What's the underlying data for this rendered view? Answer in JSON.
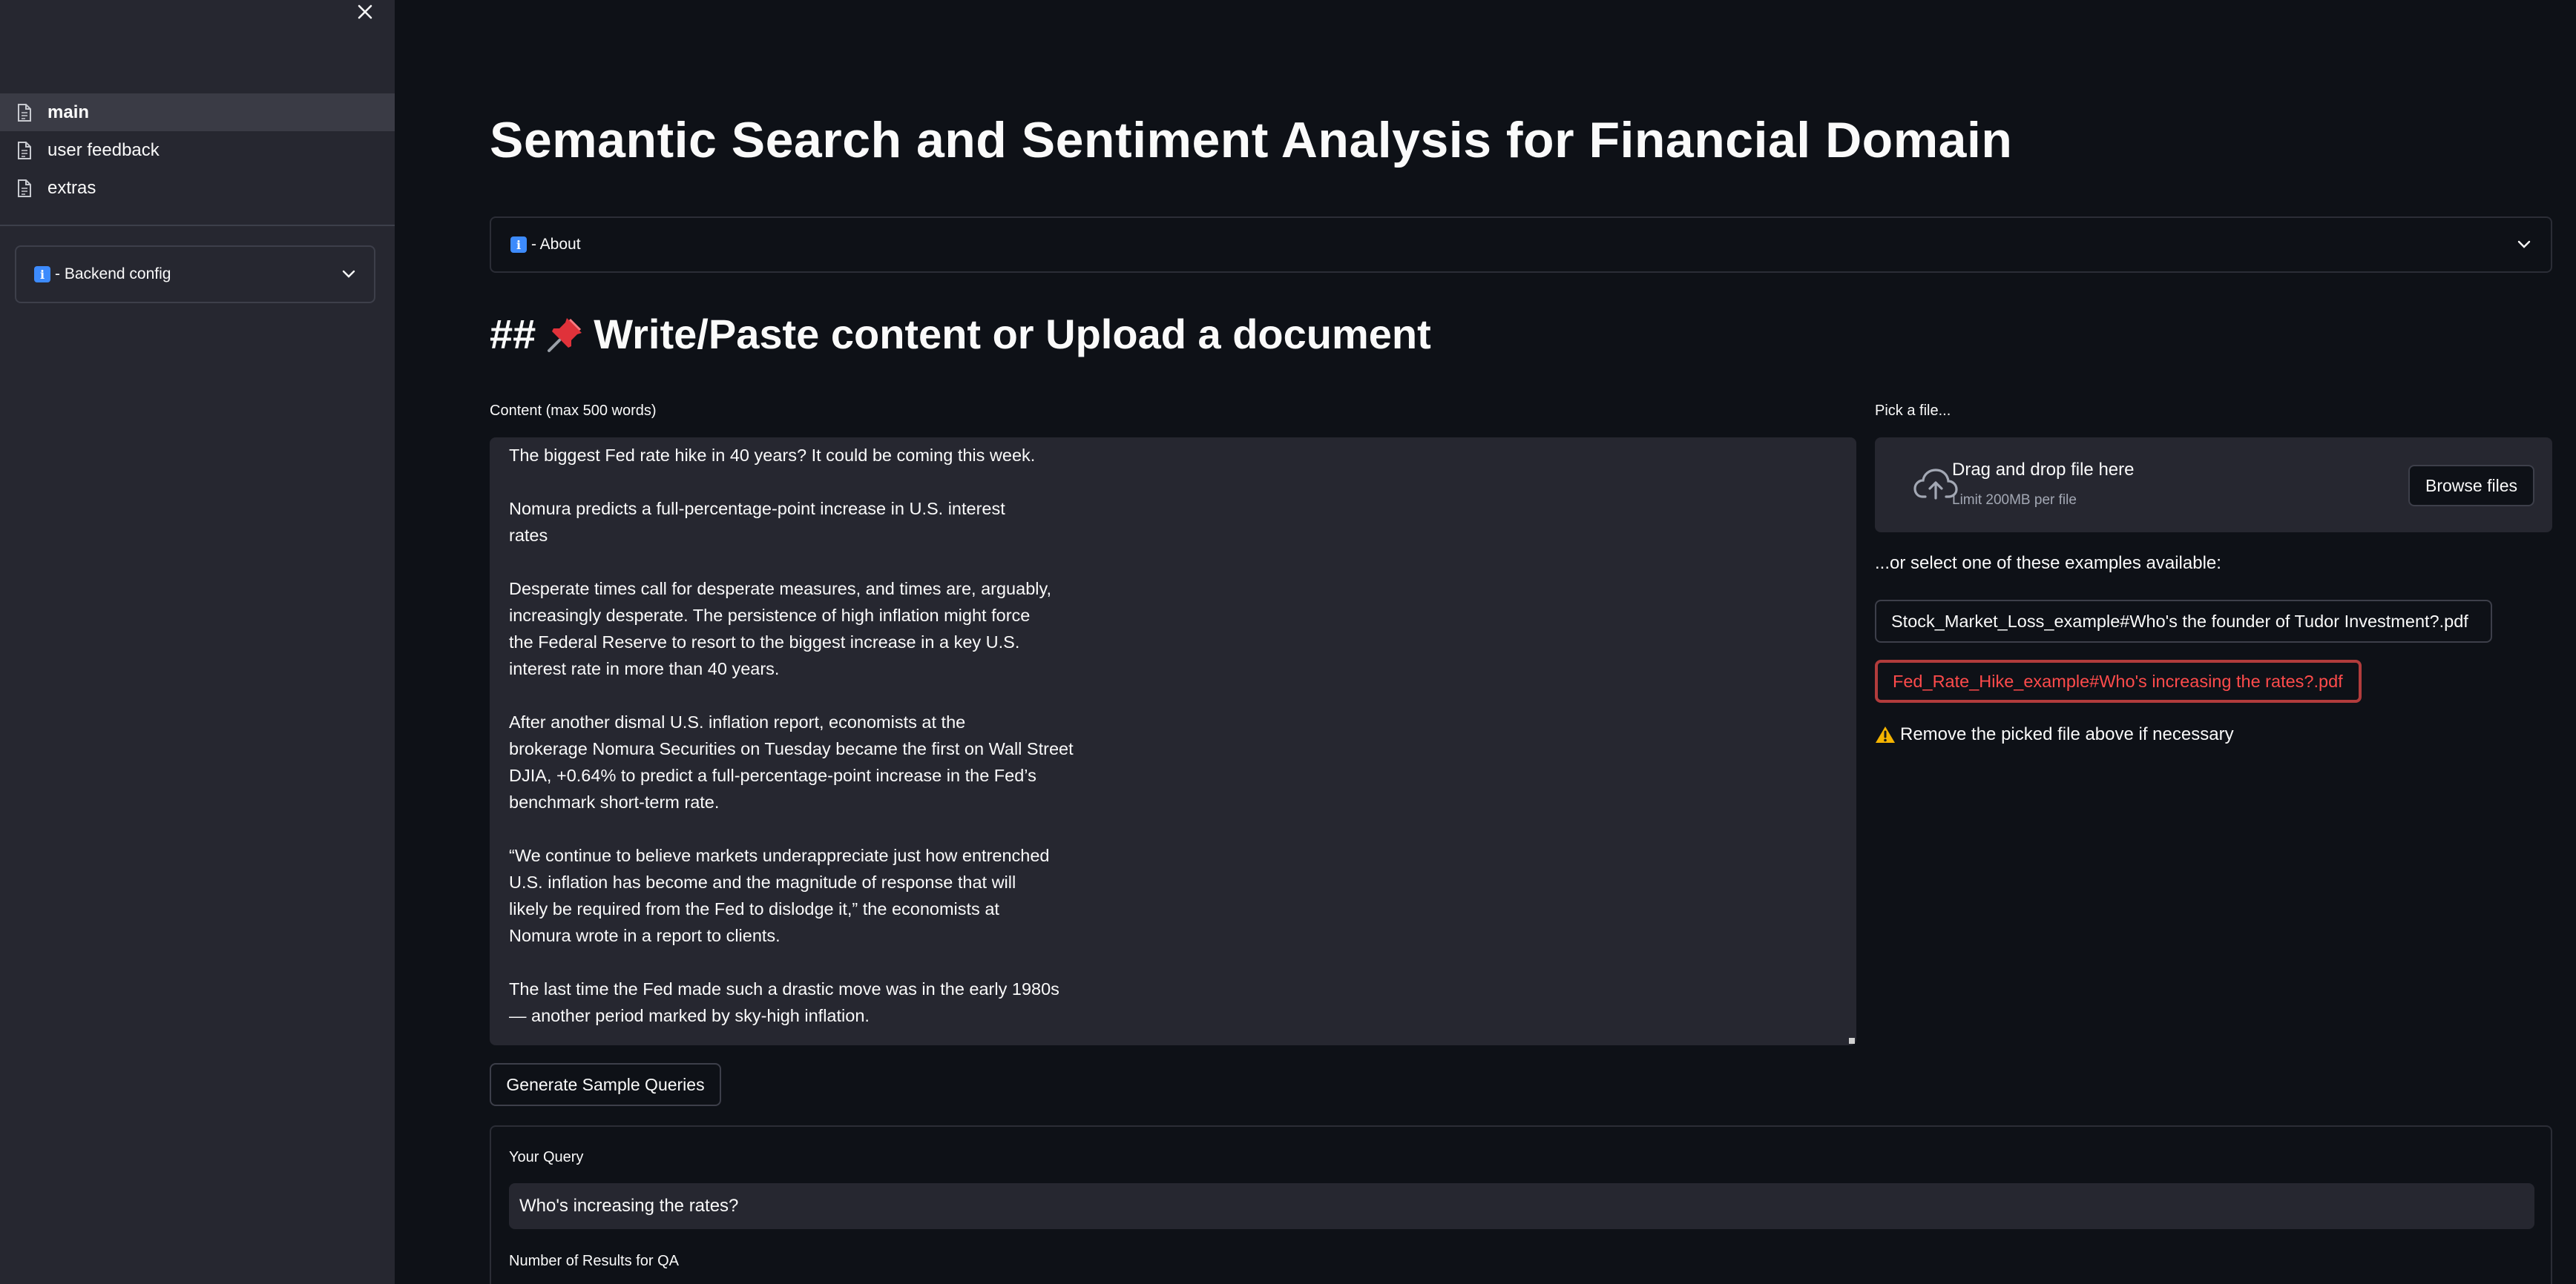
{
  "sidebar": {
    "items": [
      {
        "label": "main",
        "active": true
      },
      {
        "label": "user feedback",
        "active": false
      },
      {
        "label": "extras",
        "active": false
      }
    ],
    "backend_config_label": "- Backend config",
    "info_emoji": "i"
  },
  "main": {
    "title": "Semantic Search and Sentiment Analysis for Financial Domain",
    "about_label": "- About",
    "section_heading_prefix": "##",
    "section_heading_text": "Write/Paste content or Upload a document",
    "content_label": "Content (max 500 words)",
    "content_text": "The biggest Fed rate hike in 40 years? It could be coming this week.\n\nNomura predicts a full-percentage-point increase in U.S. interest\nrates\n\nDesperate times call for desperate measures, and times are, arguably,\nincreasingly desperate. The persistence of high inflation might force\nthe Federal Reserve to resort to the biggest increase in a key U.S.\ninterest rate in more than 40 years.\n\nAfter another dismal U.S. inflation report, economists at the\nbrokerage Nomura Securities on Tuesday became the first on Wall Street\nDJIA, +0.64% to predict a full-percentage-point increase in the Fed’s\nbenchmark short-term rate.\n\n“We continue to believe markets underappreciate just how entrenched\nU.S. inflation has become and the magnitude of response that will\nlikely be required from the Fed to dislodge it,” the economists at\nNomura wrote in a report to clients.\n\nThe last time the Fed made such a drastic move was in the early 1980s\n— another period marked by sky-high inflation.",
    "generate_button": "Generate Sample Queries",
    "query_label": "Your Query",
    "query_value": "Who's increasing the rates?",
    "results_label": "Number of Results for QA"
  },
  "uploader": {
    "label": "Pick a file...",
    "drop_title": "Drag and drop file here",
    "drop_sub": "Limit 200MB per file",
    "browse_label": "Browse files"
  },
  "examples": {
    "label": "...or select one of these examples available:",
    "items": [
      "Stock_Market_Loss_example#Who's the founder of Tudor Investment?.pdf",
      "Fed_Rate_Hike_example#Who's increasing the rates?.pdf"
    ],
    "warning": "Remove the picked file above if necessary"
  },
  "colors": {
    "background": "#0e1117",
    "sidebar": "#262730",
    "selected_example": "#ff4b4b",
    "warning": "#f5b400"
  }
}
